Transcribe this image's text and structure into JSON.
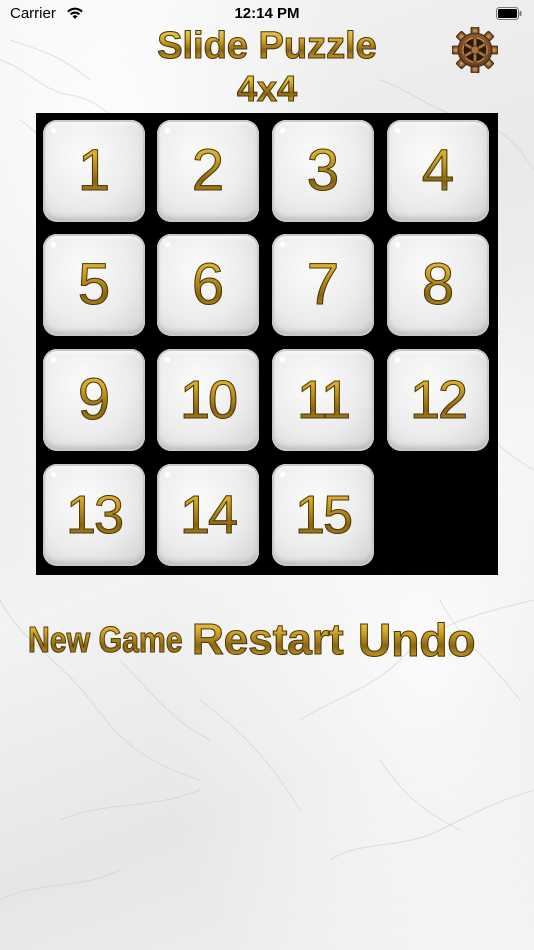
{
  "status_bar": {
    "carrier": "Carrier",
    "time": "12:14 PM"
  },
  "header": {
    "title": "Slide Puzzle",
    "subtitle": "4x4",
    "settings_icon": "gear-icon"
  },
  "board": {
    "size": 4,
    "background_color": "#000000",
    "tiles": [
      "1",
      "2",
      "3",
      "4",
      "5",
      "6",
      "7",
      "8",
      "9",
      "10",
      "11",
      "12",
      "13",
      "14",
      "15"
    ],
    "empty_position": [
      3,
      3
    ]
  },
  "controls": {
    "new_game": "New Game",
    "restart": "Restart",
    "undo": "Undo"
  },
  "colors": {
    "gold": "#c9a12a",
    "tile": "#ececec"
  }
}
